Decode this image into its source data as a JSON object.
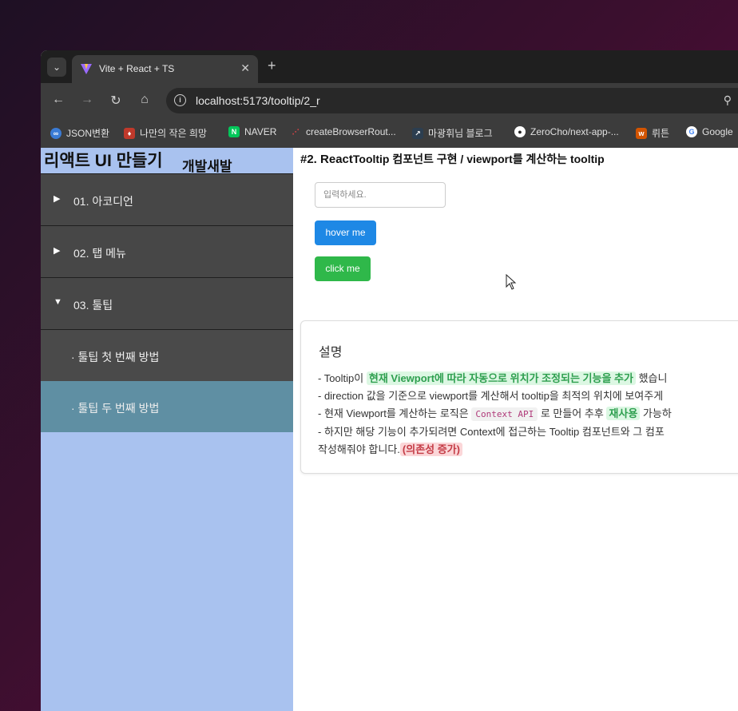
{
  "browser": {
    "tab_title": "Vite + React + TS",
    "url": "localhost:5173/tooltip/2_r",
    "bookmarks": [
      {
        "label": "JSON변환",
        "color": "#3a7bd5"
      },
      {
        "label": "나만의 작은 희망",
        "color": "#c0392b"
      },
      {
        "label": "NAVER",
        "color": "#03c75a"
      },
      {
        "label": "createBrowserRout...",
        "color": "#ca4245"
      },
      {
        "label": "마광휘님 블로그",
        "color": "#2c3e50"
      },
      {
        "label": "ZeroCho/next-app-...",
        "color": "#444444"
      },
      {
        "label": "뤼튼",
        "color": "#d35400"
      },
      {
        "label": "Google",
        "color": "#4285f4"
      }
    ]
  },
  "sidebar": {
    "title": "리액트 UI 만들기",
    "subtitle": "개발새발",
    "items": [
      {
        "label": "01. 아코디언"
      },
      {
        "label": "02. 탭 메뉴"
      },
      {
        "label": "03. 툴팁"
      }
    ],
    "subitems": [
      {
        "label": "· 툴팁 첫 번째 방법"
      },
      {
        "label": "· 툴팁 두 번째 방법"
      }
    ]
  },
  "content": {
    "heading_main": "#2. React",
    "heading_sub": "Tooltip 컴포넌트 구현 / viewport를 계산하는 tooltip",
    "input_placeholder": "입력하세요.",
    "hover_button": "hover me",
    "click_button": "click me",
    "card": {
      "title": "설명",
      "line1_pre": "- Tooltip이 ",
      "line1_hl": "현재 Viewport에 따라 자동으로 위치가 조정되는 기능을 추가",
      "line1_post": " 했습니",
      "line2": "- direction 값을 기준으로 viewport를 계산해서 tooltip을 최적의 위치에 보여주게",
      "line3_pre": "- 현재 Viewport를 계산하는 로직은 ",
      "line3_code": "Context API",
      "line3_mid": " 로 만들어 추후 ",
      "line3_hl": "재사용",
      "line3_post": " 가능하",
      "line4": "- 하지만 해당 기능이 추가되려면 Context에 접근하는 Tooltip 컴포넌트와 그 컴포",
      "line5_pre": "작성해줘야 합니다.",
      "line5_hl": "(의존성 증가)"
    }
  }
}
